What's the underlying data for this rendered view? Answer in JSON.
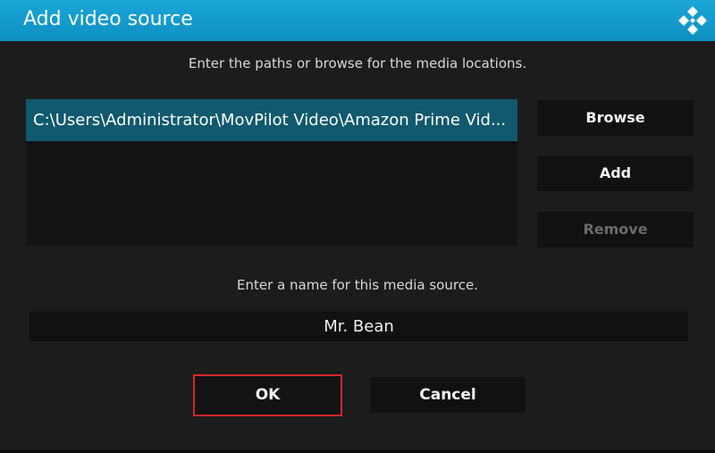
{
  "dialog": {
    "title": "Add video source",
    "logo_icon": "kodi-logo-icon",
    "paths_instruction": "Enter the paths or browse for the media locations.",
    "paths": [
      "C:\\Users\\Administrator\\MovPilot Video\\Amazon Prime Vid..."
    ],
    "browse_label": "Browse",
    "add_label": "Add",
    "remove_label": "Remove",
    "name_instruction": "Enter a name for this media source.",
    "name_value": "Mr. Bean",
    "ok_label": "OK",
    "cancel_label": "Cancel"
  },
  "colors": {
    "titlebar": "#1aa6d8",
    "selected_item": "#11596e",
    "focus_border": "#d9252c",
    "background": "#1c1c1c"
  }
}
